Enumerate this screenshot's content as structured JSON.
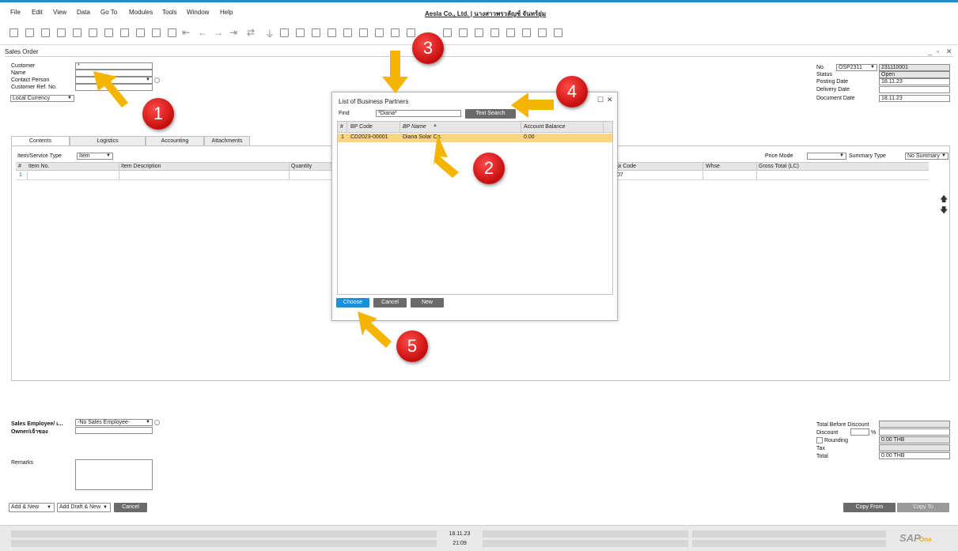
{
  "menu": [
    "File",
    "Edit",
    "View",
    "Data",
    "Go To",
    "Modules",
    "Tools",
    "Window",
    "Help"
  ],
  "company_title": "Aesla Co., Ltd. | นางสาวพรวลัญช์ จันทร์ยุ่ม",
  "form": {
    "title": "Sales Order",
    "window_controls": [
      "_",
      "▫",
      "✕"
    ]
  },
  "header_left": {
    "customer_label": "Customer",
    "customer_value": "*",
    "name_label": "Name",
    "contact_label": "Contact Person",
    "ref_label": "Customer Ref. No.",
    "currency": "Local Currency"
  },
  "header_right": {
    "no_label": "No.",
    "series": "OSP2311",
    "doc_no": "231110001",
    "status_label": "Status",
    "status_value": "Open",
    "posting_label": "Posting Date",
    "posting_value": "18.11.23",
    "delivery_label": "Delivery Date",
    "delivery_value": "",
    "docdate_label": "Document Date",
    "docdate_value": "18.11.23"
  },
  "tabs": [
    "Contents",
    "Logistics",
    "Accounting",
    "Attachments"
  ],
  "contents": {
    "type_label": "Item/Service Type",
    "type_value": "Item",
    "price_mode_label": "Price Mode",
    "summary_label": "Summary Type",
    "summary_value": "No Summary",
    "columns": [
      "#",
      "Item No.",
      "Item Description",
      "Quantity",
      "ax Code",
      "Whse",
      "Gross Total (LC)"
    ],
    "row": {
      "num": "1",
      "tax": "07"
    }
  },
  "footer_left": {
    "employee_label": "Sales Employee/ เ...",
    "employee_value": "-No Sales Employee-",
    "owner_label": "Owner/เจ้าของ",
    "remarks_label": "Remarks"
  },
  "footer_right": {
    "before_discount_label": "Total Before Discount",
    "discount_label": "Discount",
    "discount_pct": "%",
    "rounding_label": "Rounding",
    "rounding_value": "0.00 THB",
    "tax_label": "Tax",
    "total_label": "Total",
    "total_value": "0.00 THB"
  },
  "buttons": {
    "add_new": "Add & New",
    "add_draft": "Add Draft & New",
    "cancel": "Cancel",
    "copy_from": "Copy From",
    "copy_to": "Copy To"
  },
  "dialog": {
    "title": "List of Business Partners",
    "find_label": "Find",
    "find_value": "*Diana*",
    "text_search": "Text Search",
    "columns": [
      "#",
      "BP Code",
      "BP Name",
      "Account Balance"
    ],
    "rows": [
      {
        "num": "1",
        "code": "CD2023-00001",
        "name": "Diana Solar Co.",
        "balance": "0.00"
      }
    ],
    "choose": "Choose",
    "cancel": "Cancel",
    "new": "New"
  },
  "statusbar": {
    "date": "18.11.23",
    "time": "21:09",
    "brand": "SAP",
    "brand_sub": "One"
  },
  "annotations": [
    "1",
    "2",
    "3",
    "4",
    "5"
  ],
  "colors": {
    "accent": "#1b8fd8",
    "selected_row": "#fbd582",
    "arrow": "#f4b400",
    "badge": "#d71414"
  }
}
